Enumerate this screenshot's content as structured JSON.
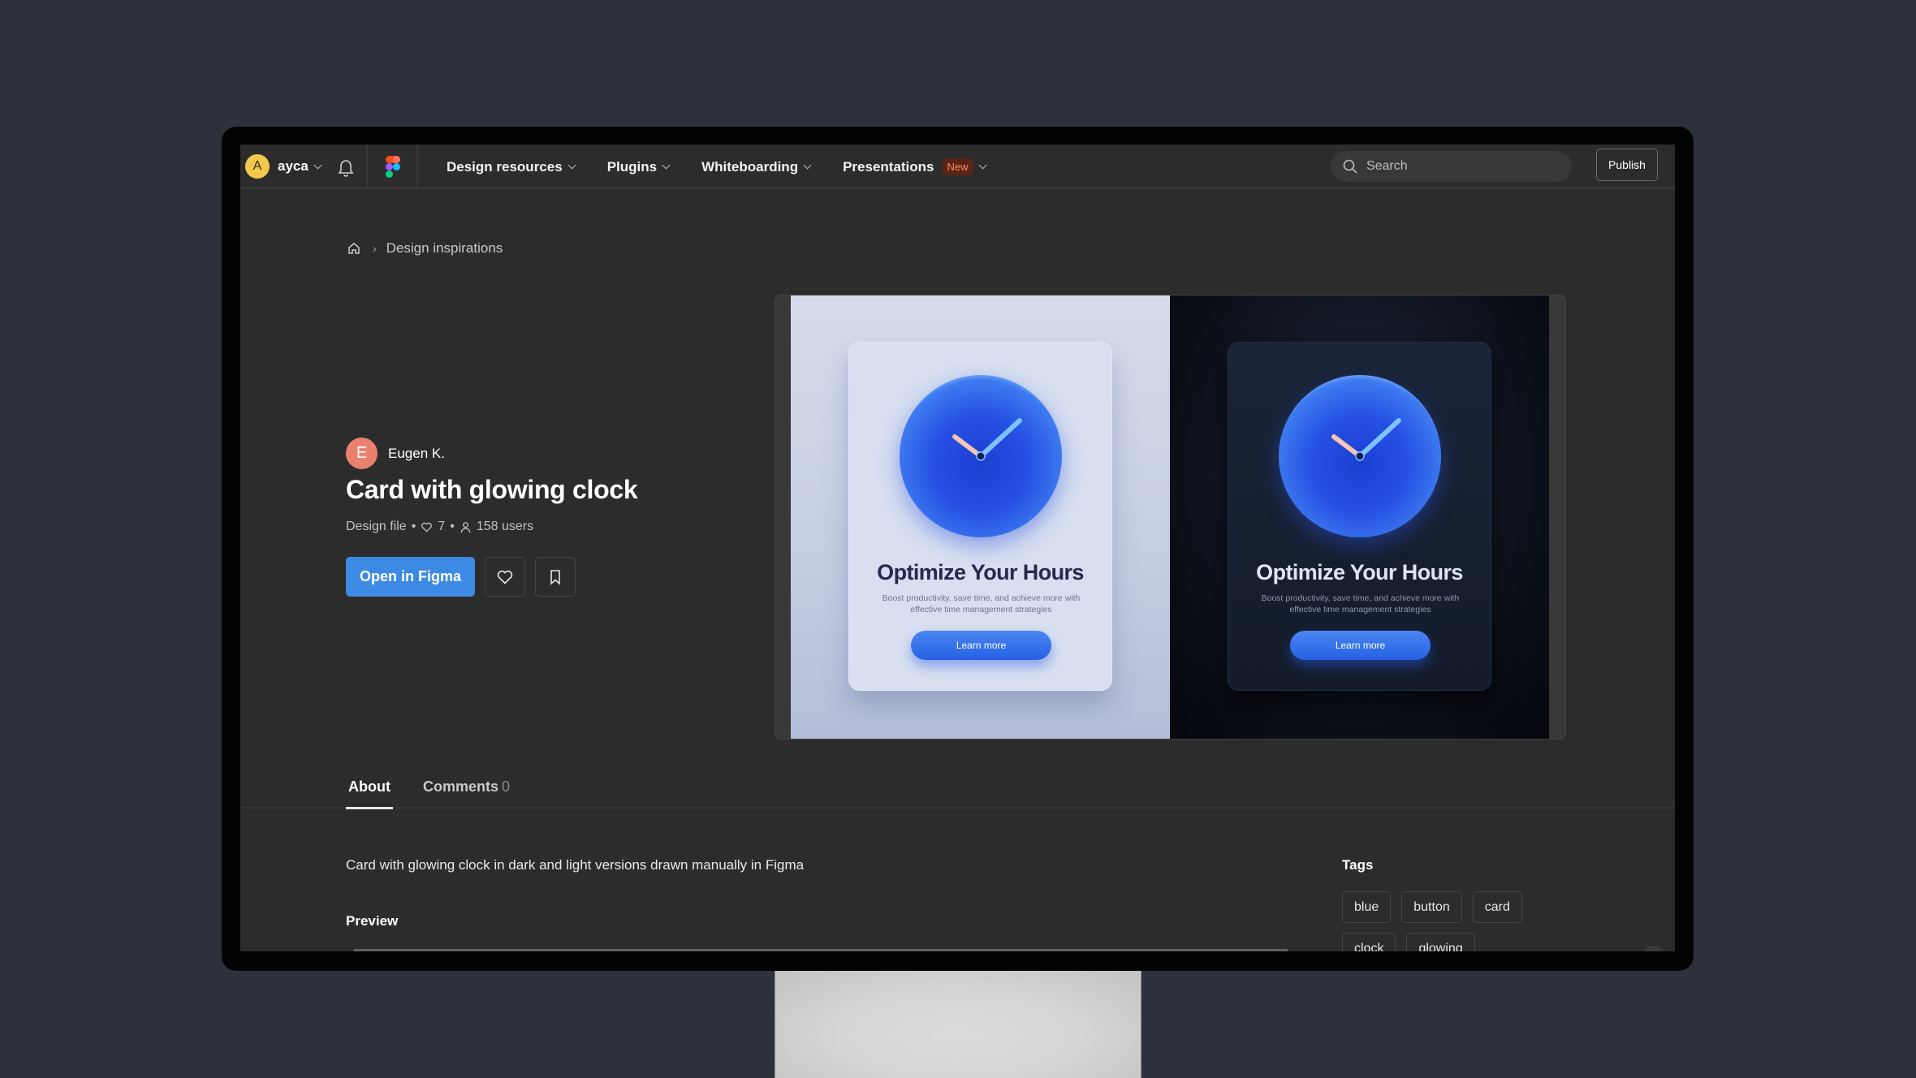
{
  "nav": {
    "user_initial": "A",
    "user_name": "ayca",
    "menu": [
      {
        "label": "Design resources"
      },
      {
        "label": "Plugins"
      },
      {
        "label": "Whiteboarding"
      },
      {
        "label": "Presentations",
        "badge": "New"
      }
    ],
    "search_placeholder": "Search",
    "publish_label": "Publish"
  },
  "breadcrumb": {
    "home_icon": "home-icon",
    "items": [
      "Design inspirations"
    ]
  },
  "resource": {
    "author_initial": "E",
    "author_name": "Eugen K.",
    "title": "Card with glowing clock",
    "type": "Design file",
    "likes": "7",
    "users": "158 users",
    "open_label": "Open in Figma",
    "accent_color": "#3d8ae5"
  },
  "preview": {
    "light_card": {
      "title": "Optimize Your Hours",
      "description": "Boost productivity, save time, and achieve more with effective time management strategies",
      "button": "Learn more"
    },
    "dark_card": {
      "title": "Optimize Your Hours",
      "description": "Boost productivity, save time, and achieve more with effective time management strategies",
      "button": "Learn more"
    }
  },
  "tabs": [
    {
      "label": "About",
      "active": true
    },
    {
      "label": "Comments",
      "count": "0",
      "active": false
    }
  ],
  "about": {
    "description": "Card with glowing clock in dark and light versions drawn manually in Figma",
    "preview_heading": "Preview"
  },
  "tags": {
    "heading": "Tags",
    "items": [
      "blue",
      "button",
      "card",
      "clock",
      "glowing"
    ]
  }
}
